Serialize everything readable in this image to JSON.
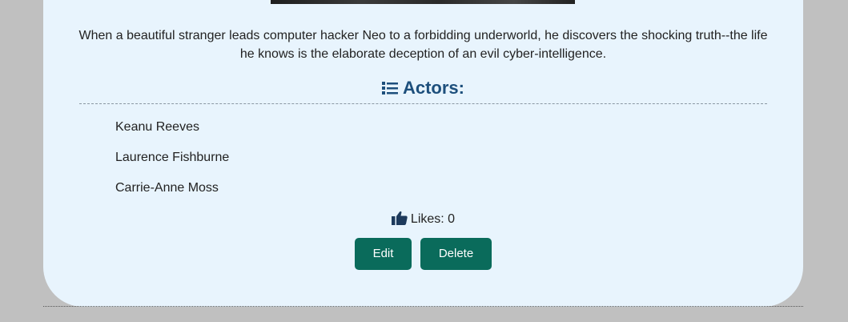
{
  "movie": {
    "description": "When a beautiful stranger leads computer hacker Neo to a forbidding underworld, he discovers the shocking truth--the life he knows is the elaborate deception of an evil cyber-intelligence."
  },
  "actors": {
    "heading": "Actors:",
    "heading_icon": "list-icon",
    "items": [
      {
        "name": "Keanu Reeves"
      },
      {
        "name": "Laurence Fishburne"
      },
      {
        "name": "Carrie-Anne Moss"
      }
    ]
  },
  "likes": {
    "icon": "thumbs-up-icon",
    "label": "Likes: 0"
  },
  "actions": {
    "edit_label": "Edit",
    "delete_label": "Delete"
  },
  "colors": {
    "page_background": "#c0c0c0",
    "card_background": "#e8f4fd",
    "heading": "#1d4f7c",
    "button": "#0a6b5b"
  }
}
